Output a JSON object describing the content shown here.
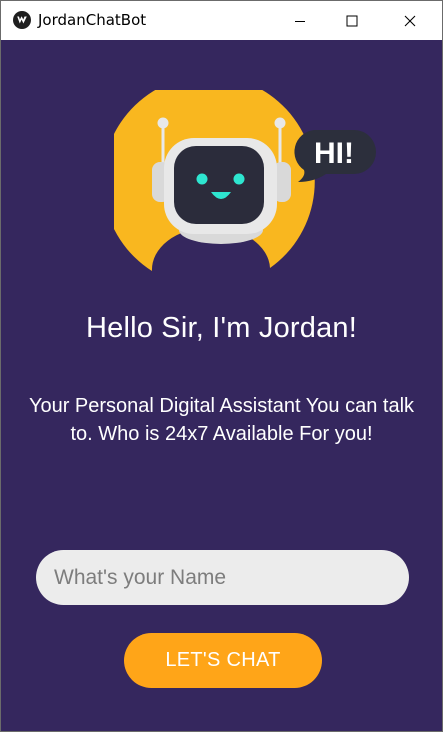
{
  "window": {
    "title": "JordanChatBot",
    "icons": {
      "app": "kivy-app-icon",
      "minimize": "minimize-icon",
      "maximize": "maximize-icon",
      "close": "close-icon"
    }
  },
  "illustration": {
    "speech_bubble_text": "HI!",
    "colors": {
      "sun": "#f9b71f",
      "robot_body": "#e8e8e8",
      "robot_face": "#2b2c3b",
      "eyes": "#2ee6d0",
      "bubble": "#2c2f3c"
    }
  },
  "main": {
    "heading": "Hello Sir, I'm Jordan!",
    "subtext": "Your Personal Digital Assistant You can talk to. Who is 24x7 Available For you!"
  },
  "form": {
    "name_placeholder": "What's your Name",
    "name_value": "",
    "submit_label": "LET'S CHAT"
  },
  "colors": {
    "background": "#35275e",
    "button": "#ffa518",
    "input_bg": "#ececec"
  }
}
